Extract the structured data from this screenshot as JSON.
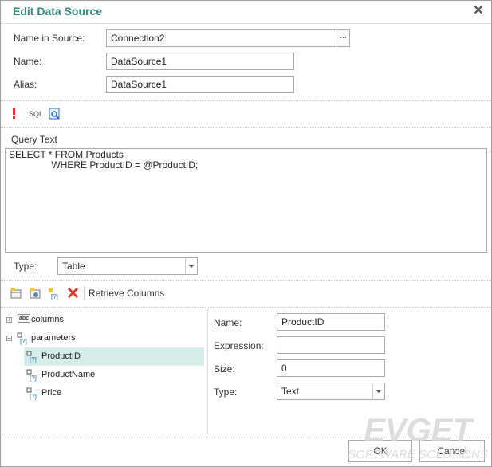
{
  "dialog": {
    "title": "Edit Data Source"
  },
  "form": {
    "name_in_source_label": "Name in Source:",
    "name_in_source_value": "Connection2",
    "browse_label": "...",
    "name_label": "Name:",
    "name_value": "DataSource1",
    "alias_label": "Alias:",
    "alias_value": "DataSource1"
  },
  "toolbar": {
    "sql_label": "SQL"
  },
  "query": {
    "label": "Query Text",
    "text": "SELECT * FROM Products\n                WHERE ProductID = @ProductID;",
    "type_label": "Type:",
    "type_value": "Table"
  },
  "columns_toolbar": {
    "retrieve_label": "Retrieve Columns"
  },
  "tree": {
    "columns_label": "columns",
    "parameters_label": "parameters",
    "params": [
      "ProductID",
      "ProductName",
      "Price"
    ]
  },
  "props": {
    "name_label": "Name:",
    "name_value": "ProductID",
    "expression_label": "Expression:",
    "expression_value": "",
    "size_label": "Size:",
    "size_value": "0",
    "type_label": "Type:",
    "type_value": "Text"
  },
  "footer": {
    "ok_label": "OK",
    "cancel_label": "Cancel"
  },
  "watermark": {
    "brand": "EVGET",
    "tagline": "SOFTWARE SOLUTIONS"
  },
  "colors": {
    "title": "#2f8a7d",
    "selection": "#d5eeea",
    "delete": "#e03a2a"
  }
}
